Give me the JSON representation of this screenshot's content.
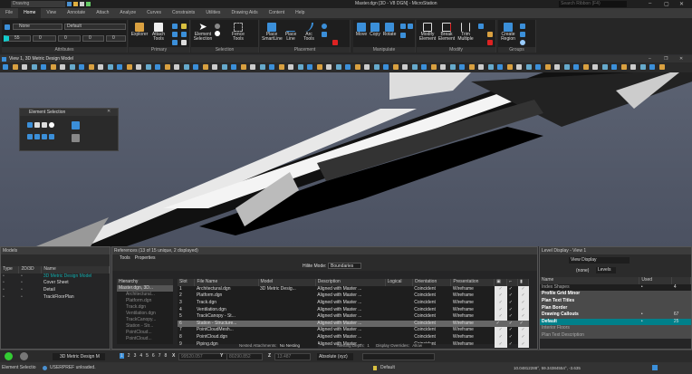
{
  "titlebar": {
    "workspace": "Drawing",
    "title": "Master.dgn [3D - V8 DGN] - MicroStation",
    "search_placeholder": "Search Ribbon (F4)"
  },
  "tabs": [
    "File",
    "Home",
    "View",
    "Annotate",
    "Attach",
    "Analyze",
    "Curves",
    "Constraints",
    "Utilities",
    "Drawing Aids",
    "Content",
    "Help"
  ],
  "active_tab": "Home",
  "ribbon": {
    "attributes": {
      "label": "Attributes",
      "level": "None",
      "style": "Default",
      "color": "55",
      "weight": "0",
      "linestyle": "0",
      "transparency": "0",
      "priority": "0"
    },
    "primary": {
      "label": "Primary",
      "buttons": [
        "Explorer",
        "Attach Tools"
      ]
    },
    "selection": {
      "label": "Selection",
      "buttons": [
        "Element Selection",
        "Fence Tools"
      ]
    },
    "placement": {
      "label": "Placement",
      "buttons": [
        "Place SmartLine",
        "Place Line",
        "Arc Tools"
      ]
    },
    "manipulate": {
      "label": "Manipulate",
      "buttons": [
        "Move",
        "Copy",
        "Rotate"
      ]
    },
    "modify": {
      "label": "Modify",
      "buttons": [
        "Modify Element",
        "Break Element",
        "Trim Multiple"
      ]
    },
    "groups": {
      "label": "Groups",
      "buttons": [
        "Create Region"
      ]
    }
  },
  "view": {
    "title": "View 1, 3D Metric Design Model"
  },
  "element_selection": {
    "title": "Element Selection"
  },
  "models": {
    "title": "Models",
    "columns": [
      "Type",
      "2D/3D",
      "Name"
    ],
    "rows": [
      "3D Metric Design Model",
      "Cover Sheet",
      "Detail",
      "TrackFloorPlan"
    ]
  },
  "references": {
    "title": "References (13 of 15 unique, 2 displayed)",
    "menu": [
      "Tools",
      "Properties"
    ],
    "hilite_label": "Hilite Mode:",
    "hilite_value": "Boundaries",
    "hierarchy_header": "Hierarchy",
    "hierarchy": [
      "Master.dgn, 3D...",
      "Architectural...",
      "Platform.dgn",
      "Track.dgn",
      "Ventilation.dgn",
      "TrackCanopy...",
      "Station - Str...",
      "PointCloud...",
      "PointCloud..."
    ],
    "columns": [
      "Slot",
      "File Name",
      "Model",
      "Description",
      "Logical",
      "Orientation",
      "Presentation"
    ],
    "rows": [
      [
        "1",
        "Architectural.dgn",
        "3D Metric Desig...",
        "Aligned with Master ...",
        "",
        "Coincident",
        "Wireframe"
      ],
      [
        "2",
        "Platform.dgn",
        "",
        "Aligned with Master ...",
        "",
        "Coincident",
        "Wireframe"
      ],
      [
        "3",
        "Track.dgn",
        "",
        "Aligned with Master ...",
        "",
        "Coincident",
        "Wireframe"
      ],
      [
        "4",
        "Ventilation.dgn",
        "",
        "Aligned with Master ...",
        "",
        "Coincident",
        "Wireframe"
      ],
      [
        "5",
        "TrackCanopy - St...",
        "",
        "Aligned with Master ...",
        "",
        "Coincident",
        "Wireframe"
      ],
      [
        "6",
        "Station - Structure...",
        "",
        "Aligned with Master ...",
        "",
        "Coincident",
        "Wireframe"
      ],
      [
        "7",
        "PointCloudMesh...",
        "",
        "Aligned with Master ...",
        "",
        "Coincident",
        "Wireframe"
      ],
      [
        "8",
        "PointCloud.dgn",
        "",
        "Aligned with Master ...",
        "",
        "Coincident",
        "Wireframe"
      ],
      [
        "9",
        "Piping.dgn",
        "",
        "Aligned with Master ...",
        "",
        "Coincident",
        "Wireframe"
      ]
    ],
    "selected_row": 5,
    "nested_label": "Nested Attachments:",
    "nested_value": "No Nesting",
    "depth_label": "Nesting Depth:",
    "depth_value": "1",
    "overrides_label": "Display Overrides:",
    "overrides_value": "Allow"
  },
  "levels": {
    "title": "Level Display - View 1",
    "display_mode": "View Display",
    "filter": "(none)",
    "levels_btn": "Levels",
    "columns": [
      "Name",
      "Used"
    ],
    "rows": [
      [
        "Index Shapes",
        "4"
      ],
      [
        "Profile Grid Minor",
        ""
      ],
      [
        "Plan Text Titles",
        ""
      ],
      [
        "Plan Border",
        ""
      ],
      [
        "Drawing Callouts",
        "67"
      ],
      [
        "Default",
        "25"
      ],
      [
        "Interior Floors",
        ""
      ],
      [
        "Plan Text Description",
        ""
      ]
    ],
    "selected": "Default"
  },
  "bottom": {
    "model": "3D Metric Design M",
    "views": [
      "1",
      "2",
      "3",
      "4",
      "5",
      "6",
      "7",
      "8"
    ],
    "x": "99520.057",
    "y": "80290.852",
    "z": "13.487",
    "coord_mode": "Absolute (xyz)"
  },
  "status": {
    "tool": "Element Selectio",
    "message": "USERPREF unloaded.",
    "level": "Default",
    "coords": "10.04812288°, 59.34384554°, -3.635"
  },
  "colors": {
    "accent": "#3b8fd9",
    "selected_level": "#00808a",
    "background": "#2d2d30"
  }
}
